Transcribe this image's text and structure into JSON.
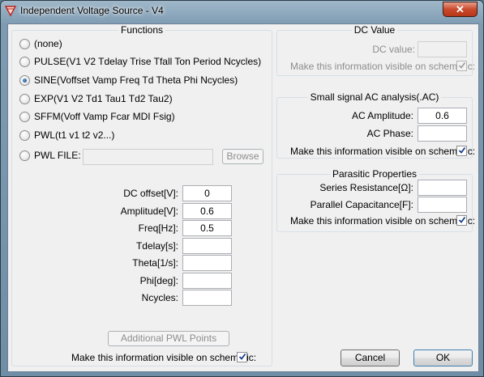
{
  "window": {
    "title": "Independent Voltage Source - V4",
    "close_glyph": "✕"
  },
  "functions": {
    "legend": "Functions",
    "options": [
      {
        "label": "(none)",
        "checked": false
      },
      {
        "label": "PULSE(V1 V2 Tdelay Trise Tfall Ton Period Ncycles)",
        "checked": false
      },
      {
        "label": "SINE(Voffset Vamp Freq Td Theta Phi Ncycles)",
        "checked": true
      },
      {
        "label": "EXP(V1 V2 Td1 Tau1 Td2 Tau2)",
        "checked": false
      },
      {
        "label": "SFFM(Voff Vamp Fcar MDI Fsig)",
        "checked": false
      },
      {
        "label": "PWL(t1 v1 t2 v2...)",
        "checked": false
      },
      {
        "label": "PWL FILE:",
        "checked": false
      }
    ],
    "pwl_file_value": "",
    "browse_label": "Browse",
    "params": [
      {
        "label": "DC offset[V]:",
        "value": "0"
      },
      {
        "label": "Amplitude[V]:",
        "value": "0.6"
      },
      {
        "label": "Freq[Hz]:",
        "value": "0.5"
      },
      {
        "label": "Tdelay[s]:",
        "value": ""
      },
      {
        "label": "Theta[1/s]:",
        "value": ""
      },
      {
        "label": "Phi[deg]:",
        "value": ""
      },
      {
        "label": "Ncycles:",
        "value": ""
      }
    ],
    "additional_pwl_label": "Additional PWL Points",
    "visible_label": "Make this information visible on schematic:",
    "visible_checked": true
  },
  "dc_value": {
    "legend": "DC Value",
    "label": "DC value:",
    "value": "",
    "visible_label": "Make this information visible on schematic:",
    "visible_checked": true
  },
  "ac": {
    "legend": "Small signal AC analysis(.AC)",
    "amplitude_label": "AC Amplitude:",
    "amplitude_value": "0.6",
    "phase_label": "AC Phase:",
    "phase_value": "",
    "visible_label": "Make this information visible on schematic:",
    "visible_checked": true
  },
  "parasitic": {
    "legend": "Parasitic Properties",
    "series_label": "Series Resistance[Ω]:",
    "series_value": "",
    "parallel_label": "Parallel Capacitance[F]:",
    "parallel_value": "",
    "visible_label": "Make this information visible on schematic:",
    "visible_checked": true
  },
  "buttons": {
    "cancel": "Cancel",
    "ok": "OK"
  }
}
